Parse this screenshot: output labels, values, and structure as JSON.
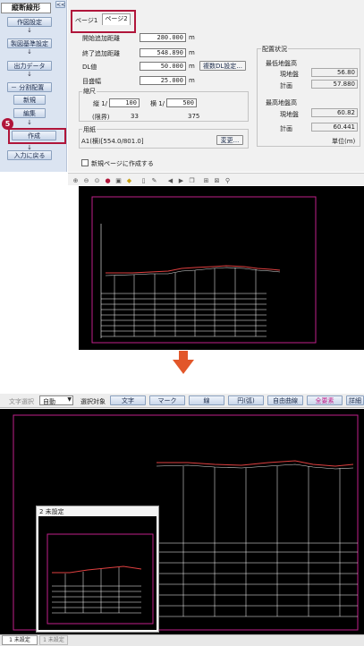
{
  "sidebar": {
    "collapse": "<<",
    "title": "縦断線形",
    "steps": [
      "作図設定",
      "製図基準設定",
      "出力データ",
      "－ 分割配置",
      "新規",
      "編集",
      "作成",
      "入力に戻る"
    ],
    "arrow": "↓",
    "badge": "5"
  },
  "tabs": [
    "ページ1",
    "ページ2"
  ],
  "form": {
    "dist_label": "開始追加距離",
    "dist_value": "280.000",
    "unit_m": "m",
    "end_label": "終了追加距離",
    "end_value": "548.890",
    "dl_label": "DL値",
    "dl_value": "50.000",
    "dl_button": "複数DL設定...",
    "grid_label": "目盛幅",
    "grid_value": "25.000",
    "scale_title": "縮尺",
    "vert_label": "縦 1/",
    "vert_value": "100",
    "horiz_label": "横 1/",
    "horiz_value": "500",
    "limit_label": "(限界)",
    "limit_v": "33",
    "limit_h": "375",
    "paper_title": "用紙",
    "paper_value": "A1(横)[554.0/801.0]",
    "change_button": "変更...",
    "newpage_label": "新規ページに作成する"
  },
  "layout": {
    "title": "配置状況",
    "low": "最低地盤高",
    "high": "最高地盤高",
    "ground": "現地盤",
    "plan": "計画",
    "low_ground": "56.80",
    "low_plan": "57.880",
    "high_ground": "60.82",
    "high_plan": "60.441",
    "unit": "単位(m)"
  },
  "toolbar": {
    "select_label": "文字選択",
    "select_value": "自動",
    "target_label": "選択対象",
    "buttons": [
      "文字",
      "マーク",
      "線",
      "円(弧)",
      "自由曲線",
      "全要素",
      "詳細"
    ]
  },
  "popup_title": "2 未設定",
  "bottom_tabs": [
    "1 未設定",
    "1 未設定"
  ],
  "colors": {
    "highlight": "#b0153a",
    "arrow": "#e2572a",
    "accent": "#c0208a"
  }
}
